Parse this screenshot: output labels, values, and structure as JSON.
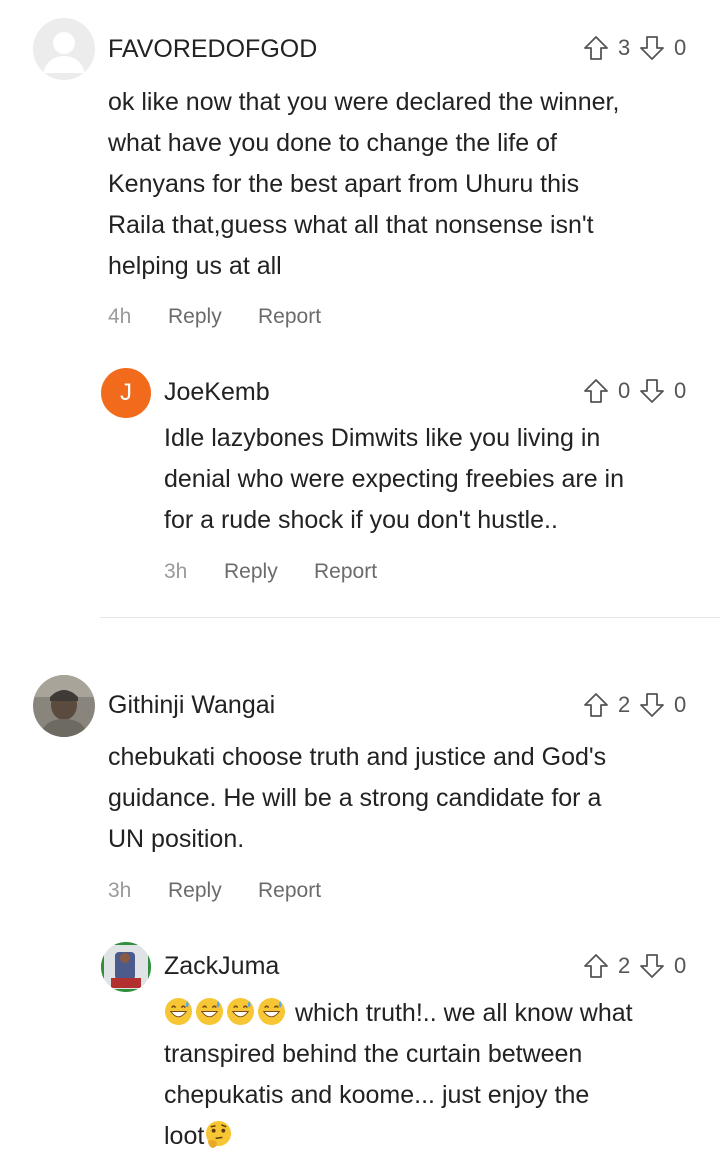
{
  "comments": [
    {
      "author": "FAVOREDOFGOD",
      "upvotes": "3",
      "downvotes": "0",
      "text_lines": [
        "ok like now that you were declared the winner,",
        "what have you done to change the life of",
        "Kenyans for the best apart from Uhuru this",
        "Raila that,guess what all that nonsense isn't",
        "helping us at all"
      ],
      "time": "4h",
      "reply_label": "Reply",
      "report_label": "Report",
      "avatar_icon": "default-user-icon"
    },
    {
      "author": "JoeKemb",
      "avatar_letter": "J",
      "avatar_color": "#f26a1b",
      "upvotes": "0",
      "downvotes": "0",
      "text_lines": [
        "Idle lazybones Dimwits like you living in",
        "denial who were expecting freebies are in",
        "for a rude shock if you don't hustle.."
      ],
      "time": "3h",
      "reply_label": "Reply",
      "report_label": "Report"
    },
    {
      "author": "Githinji Wangai",
      "upvotes": "2",
      "downvotes": "0",
      "text_lines": [
        "chebukati choose truth and justice and God's",
        "guidance.  He will be a strong candidate for a",
        "UN position."
      ],
      "time": "3h",
      "reply_label": "Reply",
      "report_label": "Report",
      "avatar_icon": "profile-photo"
    },
    {
      "author": "ZackJuma",
      "upvotes": "2",
      "downvotes": "0",
      "text_lines": [
        "which truth!.. we all know what",
        "transpired behind the curtain between",
        "chepukatis and koome... just enjoy the",
        "loot"
      ],
      "avatar_icon": "profile-photo",
      "emoji_prefix": [
        "grinning-sweat-emoji",
        "grinning-sweat-emoji",
        "grinning-sweat-emoji",
        "grinning-sweat-emoji"
      ],
      "emoji_suffix": "thinking-face-emoji"
    }
  ]
}
